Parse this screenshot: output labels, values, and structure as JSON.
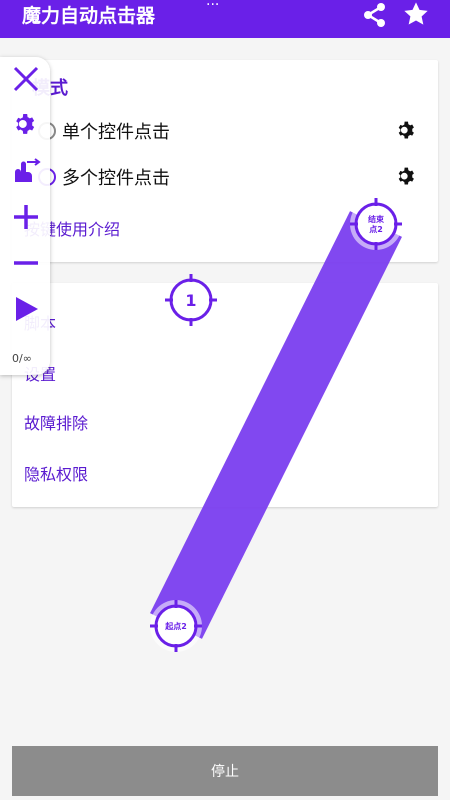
{
  "app": {
    "title": "魔力自动点击器",
    "dots": "···"
  },
  "mode_card": {
    "title": "模式",
    "options": [
      {
        "label": "单个控件点击",
        "selected": false
      },
      {
        "label": "多个控件点击",
        "selected": true
      }
    ]
  },
  "links": {
    "shortcut": "按键使用介绍",
    "script": "脚本",
    "settings": "设置",
    "troubleshoot": "故障排除",
    "privacy": "隐私权限"
  },
  "float_bar": {
    "loop_count": "0/∞"
  },
  "targets": {
    "single_point": "1",
    "swipe_end": [
      "结束",
      "点2"
    ],
    "swipe_start": "起点2"
  },
  "bottom": {
    "stop_label": "停止"
  },
  "colors": {
    "primary": "#6a20e8",
    "swipe": "#7b3ff0",
    "stop_bg": "#8c8c8c"
  }
}
